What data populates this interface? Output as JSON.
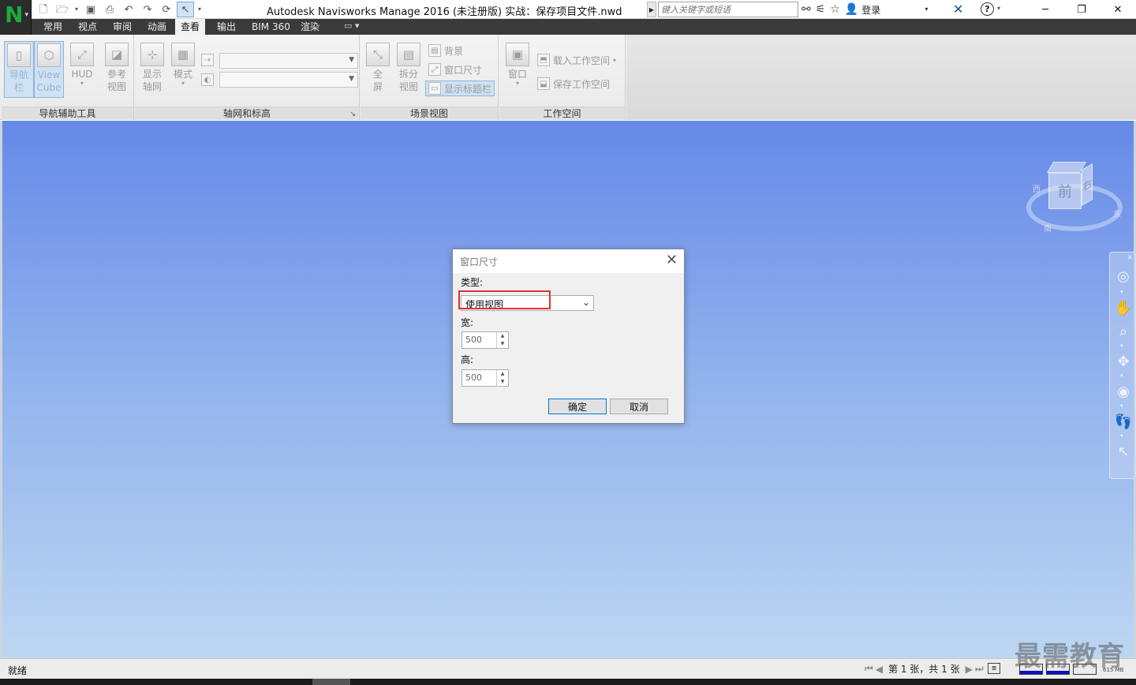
{
  "titlebar": {
    "title": "Autodesk Navisworks Manage 2016 (未注册版)    实战：保存项目文件.nwd",
    "search_placeholder": "键入关键字或短语",
    "login_label": "登录",
    "minimize": "─",
    "restore": "❐",
    "close": "✕"
  },
  "tabs": [
    "常用",
    "视点",
    "审阅",
    "动画",
    "查看",
    "输出",
    "BIM 360",
    "渲染"
  ],
  "active_tab": "查看",
  "ribbon": {
    "nav_aids": {
      "title": "导航辅助工具",
      "nav_bar_label": "导航\n栏",
      "viewcube_label": "View\nCube",
      "hud_label": "HUD",
      "reference_views_label": "参考\n视图"
    },
    "grids_levels": {
      "title": "轴网和标高",
      "show_grid_label": "显示\n轴网",
      "mode_label": "模式"
    },
    "scene_view": {
      "title": "场景视图",
      "fullscreen_label": "全\n屏",
      "split_view_label": "拆分\n视图",
      "background_label": "背景",
      "window_size_label": "窗口尺寸",
      "show_titlebar_label": "显示标题栏"
    },
    "workspace": {
      "title": "工作空间",
      "window_label": "窗口",
      "load_workspace_label": "载入工作空间",
      "save_workspace_label": "保存工作空间"
    }
  },
  "viewcube": {
    "front_face": "前",
    "right_face": "右",
    "compass_west": "西",
    "compass_south": "南",
    "compass_east": "东"
  },
  "dialog": {
    "title": "窗口尺寸",
    "type_label": "类型:",
    "type_value": "使用视图",
    "width_label": "宽:",
    "width_value": "500",
    "height_label": "高:",
    "height_value": "500",
    "ok_label": "确定",
    "cancel_label": "取消"
  },
  "statusbar": {
    "status_text": "就绪",
    "sheet_info": "第 1 张，共 1 张",
    "memory": "615 MB"
  },
  "watermark": "最需教育",
  "colors": {
    "viewport_top": "#6689e8",
    "viewport_bottom": "#bcd6f2",
    "highlight": "#e23030",
    "logo_green": "#1faa3a"
  }
}
